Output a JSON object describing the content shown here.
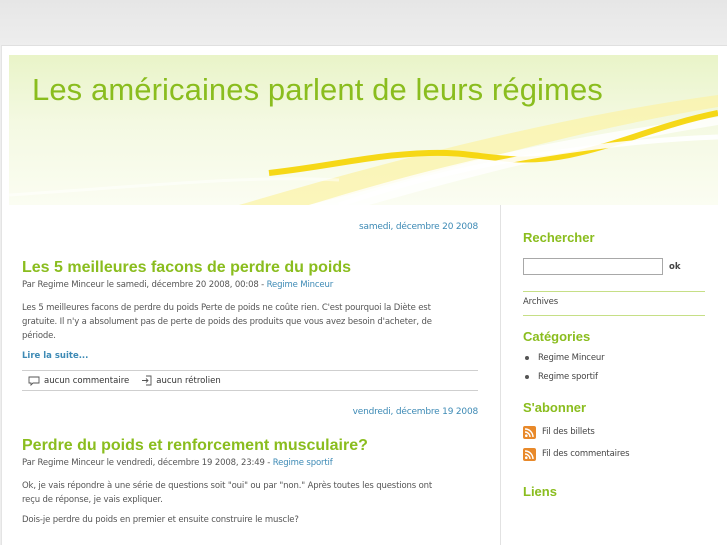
{
  "site": {
    "title": "Les américaines parlent de leurs régimes"
  },
  "posts": [
    {
      "date": "samedi, décembre 20 2008",
      "title": "Les 5 meilleures facons de perdre du poids",
      "meta_prefix": "Par Regime Minceur le samedi, décembre 20 2008, 00:08 - ",
      "category": "Regime Minceur",
      "excerpt_lines": [
        "Les 5 meilleures facons de perdre du poids Perte de poids ne coûte rien. C'est pourquoi la Diète est",
        "gratuite. Il n'y a absolument pas de perte de poids des produits que vous avez besoin d'acheter, de",
        "période."
      ],
      "read_more": "Lire la suite...",
      "comments": "aucun commentaire",
      "trackbacks": "aucun rétrolien"
    },
    {
      "date": "vendredi, décembre 19 2008",
      "title": "Perdre du poids et renforcement musculaire?",
      "meta_prefix": "Par Regime Minceur le vendredi, décembre 19 2008, 23:49 - ",
      "category": "Regime sportif",
      "excerpt_lines": [
        "Ok, je vais répondre à une série de questions soit \"oui\" ou par \"non.\" Après toutes les questions ont",
        "reçu de réponse, je vais expliquer.",
        "Dois-je perdre du poids en premier et ensuite construire le muscle?"
      ]
    }
  ],
  "sidebar": {
    "search_heading": "Rechercher",
    "search_value": "",
    "search_button": "ok",
    "archives_link": "Archives",
    "categories_heading": "Catégories",
    "categories": [
      "Regime Minceur",
      "Regime sportif"
    ],
    "subscribe_heading": "S'abonner",
    "feeds": [
      "Fil des billets",
      "Fil des commentaires"
    ],
    "links_heading": "Liens"
  },
  "colors": {
    "accent_green": "#8abd1e",
    "link_blue": "#3d8ab5",
    "rss_orange": "#e8892a"
  },
  "icons": [
    "comment-icon",
    "trackback-icon",
    "rss-icon"
  ]
}
